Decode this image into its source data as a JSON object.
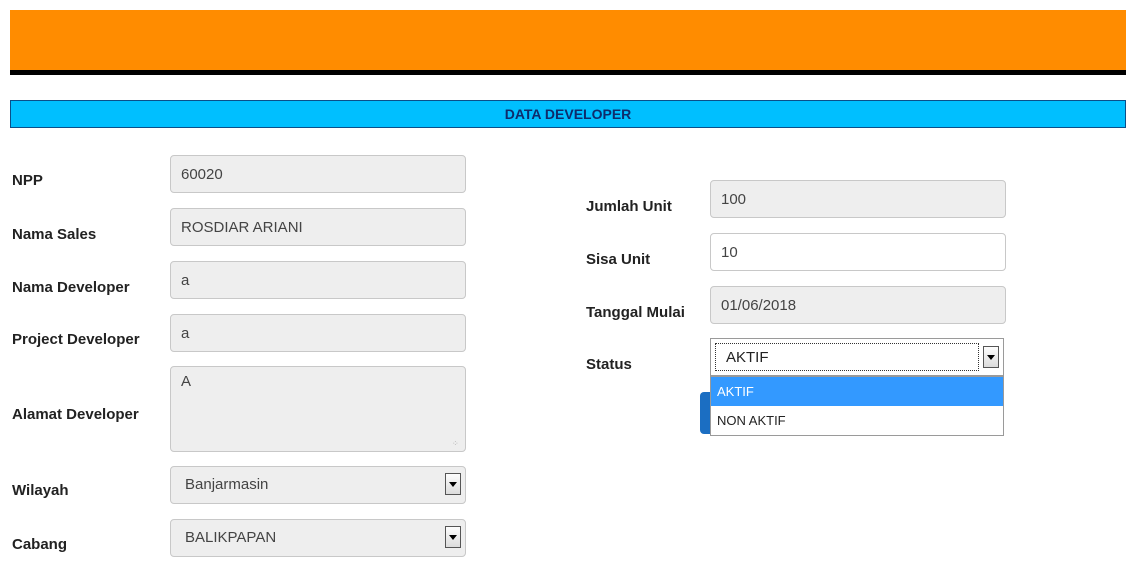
{
  "header": {
    "title": "DATA DEVELOPER",
    "colors": {
      "topbar": "#ff8c00",
      "section": "#00bfff"
    }
  },
  "form_left": {
    "npp": {
      "label": "NPP",
      "value": "60020"
    },
    "nama_sales": {
      "label": "Nama Sales",
      "value": "ROSDIAR ARIANI"
    },
    "nama_developer": {
      "label": "Nama Developer",
      "value": "a"
    },
    "project_developer": {
      "label": "Project Developer",
      "value": "a"
    },
    "alamat_developer": {
      "label": "Alamat Developer",
      "value": "A"
    },
    "wilayah": {
      "label": "Wilayah",
      "value": "Banjarmasin"
    },
    "cabang": {
      "label": "Cabang",
      "value": "BALIKPAPAN"
    }
  },
  "form_right": {
    "jumlah_unit": {
      "label": "Jumlah Unit",
      "value": "100"
    },
    "sisa_unit": {
      "label": "Sisa Unit",
      "value": "10"
    },
    "tanggal_mulai": {
      "label": "Tanggal Mulai",
      "value": "01/06/2018"
    },
    "status": {
      "label": "Status",
      "value": "AKTIF",
      "options": [
        "AKTIF",
        "NON AKTIF"
      ]
    }
  }
}
